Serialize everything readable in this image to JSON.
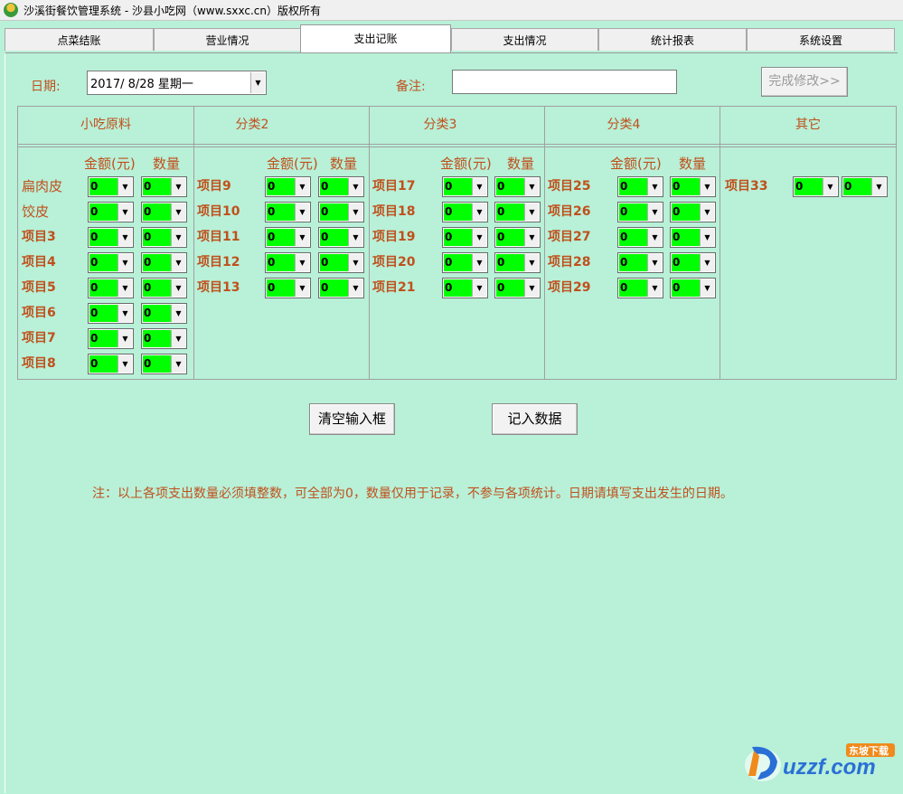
{
  "window": {
    "title": "沙溪街餐饮管理系统 - 沙县小吃网（www.sxxc.cn）版权所有"
  },
  "tabs": [
    "点菜结账",
    "营业情况",
    "支出记账",
    "支出情况",
    "统计报表",
    "系统设置"
  ],
  "active_tab": 2,
  "form": {
    "date_label": "日期:",
    "date_value": "2017/ 8/28 星期一",
    "note_label": "备注:",
    "note_value": "",
    "complete_button": "完成修改>>"
  },
  "headers": [
    "小吃原料",
    "分类2",
    "分类3",
    "分类4",
    "其它"
  ],
  "col_labels": {
    "amount": "金额(元)",
    "quantity": "数量"
  },
  "categories": [
    {
      "items": [
        "扁肉皮",
        "饺皮",
        "项目3",
        "项目4",
        "项目5",
        "项目6",
        "项目7",
        "项目8"
      ]
    },
    {
      "items": [
        "项目9",
        "项目10",
        "项目11",
        "项目12",
        "项目13"
      ]
    },
    {
      "items": [
        "项目17",
        "项目18",
        "项目19",
        "项目20",
        "项目21"
      ]
    },
    {
      "items": [
        "项目25",
        "项目26",
        "项目27",
        "项目28",
        "项目29"
      ]
    },
    {
      "items": [
        "项目33"
      ]
    }
  ],
  "default_value": "0",
  "buttons": {
    "clear": "清空输入框",
    "record": "记入数据"
  },
  "footnote": "注：以上各项支出数量必须填整数，可全部为0，数量仅用于记录，不参与各项统计。日期请填写支出发生的日期。",
  "watermark": {
    "text": "uzzf.com",
    "badge": "东坡下载"
  },
  "colors": {
    "background": "#b8f0d8",
    "label": "#c0501c",
    "value_fill": "#00ff00"
  }
}
